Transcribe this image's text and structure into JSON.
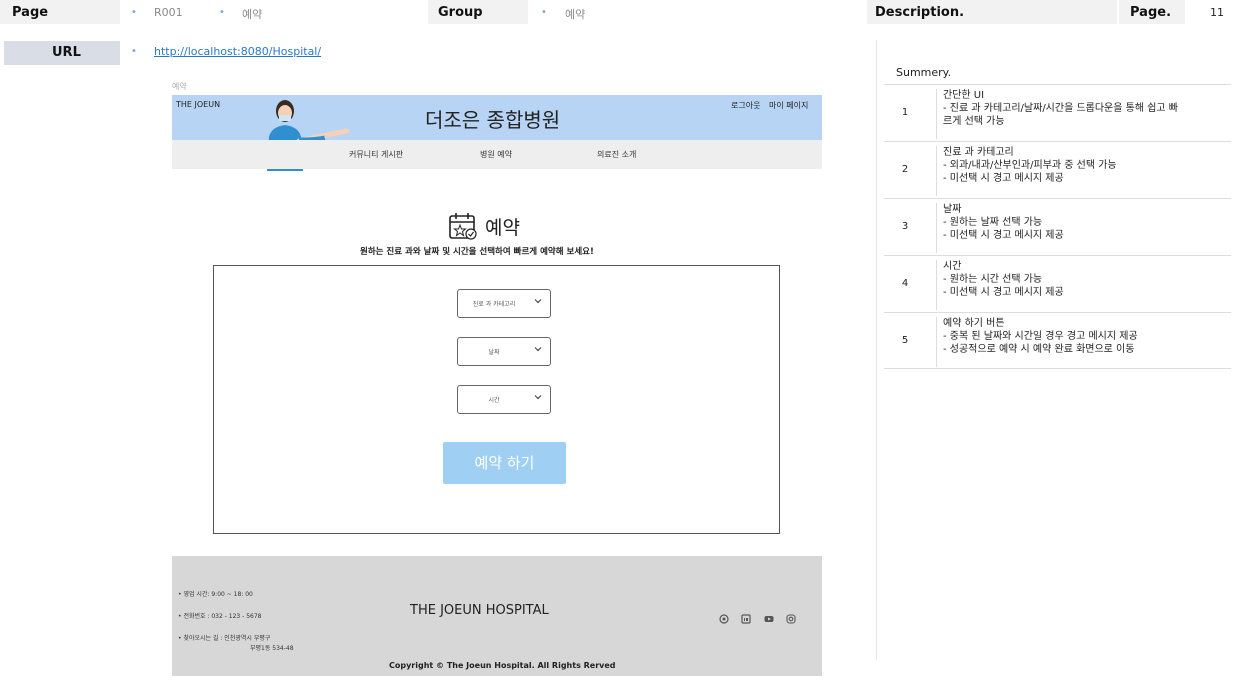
{
  "header": {
    "page_label": "Page",
    "page_id": "R001",
    "page_name": "예약",
    "group_label": "Group",
    "group_value": "예약",
    "description_label": "Description.",
    "page_num_label": "Page.",
    "page_num_value": "11",
    "url_label": "URL",
    "url_value": "http://localhost:8080/Hospital/"
  },
  "mock": {
    "frame_caption": "예약",
    "brand": "THE JOEUN",
    "title": "더조은 종합병원",
    "top_links": [
      "로그아웃",
      "마이 페이지"
    ],
    "nav": [
      "커뮤니티 게시판",
      "병원 예약",
      "의료진 소개"
    ],
    "reserve_title": "예약",
    "reserve_subtitle": "원하는 진료 과와 날짜 및 시간을 선택하여 빠르게 예약해 보세요!",
    "selects": [
      "진료 과 카테고리",
      "날짜",
      "시간"
    ],
    "submit_label": "예약 하기",
    "footer": {
      "hours": "• 영업 시간: 9:00 ~ 18: 00",
      "phone": "• 전화번호 : 032 - 123 - 5678",
      "addr1": "• 찾아오시는 길 : 인천광역시 부평구",
      "addr2": "부평1동 534-48",
      "name": "THE JOEUN HOSPITAL",
      "copyright": "Copyright © The Joeun Hospital. All Rights Rerved"
    }
  },
  "description": {
    "summary_label": "Summery.",
    "rows": [
      {
        "num": "1",
        "lines": [
          "간단한 UI",
          "- 진료 과 카테고리/날짜/시간을 드롭다운을 통해 쉽고 빠",
          "르게 선택 가능"
        ]
      },
      {
        "num": "2",
        "lines": [
          "진료 과 카테고리",
          "-   외과/내과/산부인과/피부과 중 선택 가능",
          "-   미선택 시 경고 메시지 제공"
        ]
      },
      {
        "num": "3",
        "lines": [
          "날짜",
          "-   원하는 날짜 선택 가능",
          "-   미선택 시 경고 메시지 제공"
        ]
      },
      {
        "num": "4",
        "lines": [
          "시간",
          "-   원하는 시간 선택 가능",
          "-   미선택 시 경고 메시지 제공"
        ]
      },
      {
        "num": "5",
        "lines": [
          "예약 하기 버튼",
          "-   중복 된 날짜와 시간일 경우 경고 메시지 제공",
          "-   성공적으로 예약 시 예약 완료 화면으로 이동"
        ]
      }
    ]
  },
  "colors": {
    "banner": "#b8d4f5",
    "submit": "#9fcff3",
    "footer": "#d7d7d7",
    "link": "#2a78c8"
  }
}
